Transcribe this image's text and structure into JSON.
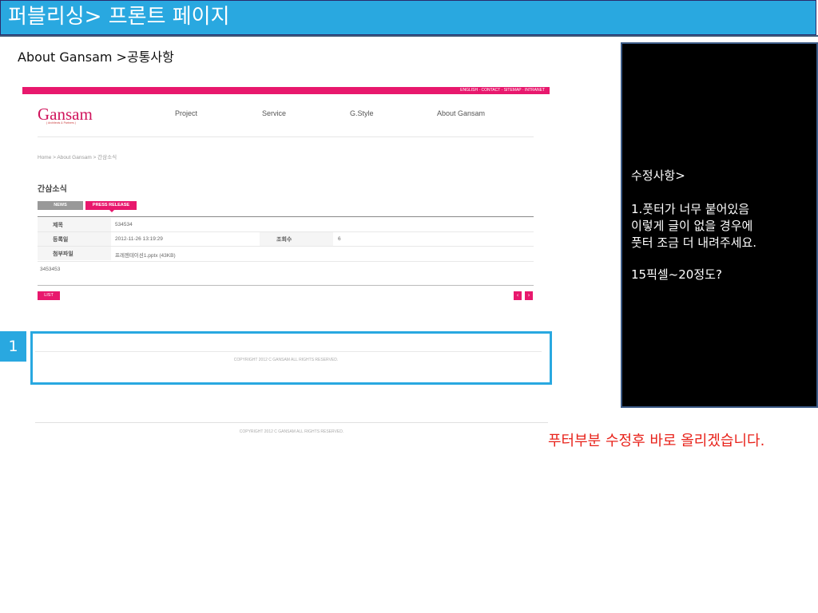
{
  "slide": {
    "title": "퍼블리싱> 프론트 페이지",
    "breadcrumb": "About Gansam >공통사항"
  },
  "site": {
    "utility_links": "ENGLISH · CONTACT · SITEMAP · INTRANET",
    "logo": "Gansam",
    "logo_sub": "( Architects & Partners )",
    "nav": [
      "Project",
      "Service",
      "G.Style",
      "About Gansam"
    ],
    "breadcrumb": "Home > About Gansam > 간삼소식",
    "page_heading": "간삼소식",
    "tabs": [
      {
        "label": "NEWS",
        "active": false
      },
      {
        "label": "PRESS RELEASE",
        "active": true
      }
    ],
    "table": {
      "title_label": "제목",
      "title_value": "534534",
      "date_label": "등록일",
      "date_value": "2012-11-26 13:19:29",
      "views_label": "조회수",
      "views_value": "6",
      "attachment_label": "첨부파일",
      "attachment_value": "프레젠테이션1.pptx (43KB)"
    },
    "body_text": "3453453",
    "list_button": "LIST",
    "prev_icon": "chevron-left-icon",
    "next_icon": "chevron-right-icon",
    "prev_glyph": "‹",
    "next_glyph": "›",
    "footer_copyright": "COPYRIGHT 2012 C GANSAM ALL RIGHTS RESERVED."
  },
  "callout": {
    "number": "1",
    "copyright": "COPYRIGHT 2012 C GANSAM ALL RIGHTS RESERVED."
  },
  "notes": {
    "heading": "수정사항>",
    "line1": "1.풋터가 너무 붙어있음",
    "line2": "이렇게 글이 없을 경우에",
    "line3": "풋터 조금 더 내려주세요.",
    "line4": "15픽셀~20정도?"
  },
  "red_note": "푸터부분 수정후 바로 올리겠습니다.",
  "colors": {
    "header_blue": "#29a8e0",
    "brand_pink": "#e8186d",
    "note_red": "#e8221a"
  }
}
